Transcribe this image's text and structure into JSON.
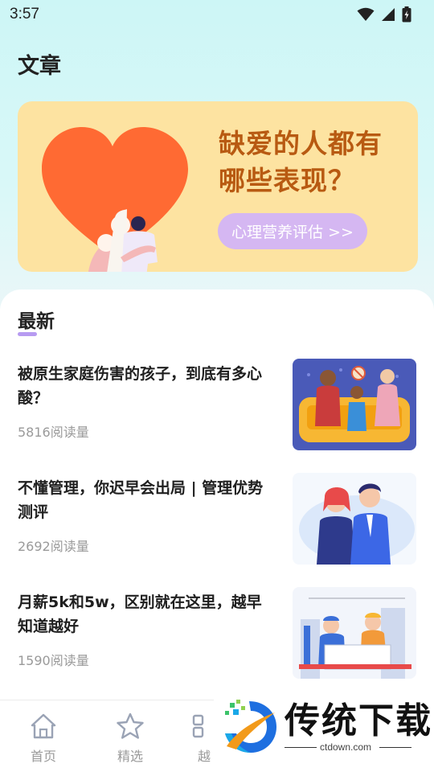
{
  "status_bar": {
    "time": "3:57"
  },
  "page": {
    "title": "文章"
  },
  "banner": {
    "headline_line1": "缺爱的人都有",
    "headline_line2": "哪些表现？",
    "button_label": "心理营养评估 >>",
    "colors": {
      "background": "#fde3a1",
      "heart": "#ff6a33",
      "headline": "#b85a12",
      "button": "#d5b7f2"
    }
  },
  "section": {
    "title": "最新",
    "accent": "#b79bf1"
  },
  "articles": [
    {
      "title": "被原生家庭伤害的孩子，到底有多心酸？",
      "reads": "5816阅读量",
      "thumb_icon": "family-sofa-illustration"
    },
    {
      "title": "不懂管理，你迟早会出局 | 管理优势测评",
      "reads": "2692阅读量",
      "thumb_icon": "business-couple-illustration"
    },
    {
      "title": "月薪5k和5w，区别就在这里，越早知道越好",
      "reads": "1590阅读量",
      "thumb_icon": "workers-illustration"
    }
  ],
  "tabbar": {
    "items": [
      {
        "label": "首页",
        "icon": "home-icon"
      },
      {
        "label": "精选",
        "icon": "star-icon"
      },
      {
        "label": "越",
        "icon": "grid-icon"
      }
    ]
  },
  "watermark": {
    "brand": "传统下载",
    "url": "ctdown.com"
  }
}
